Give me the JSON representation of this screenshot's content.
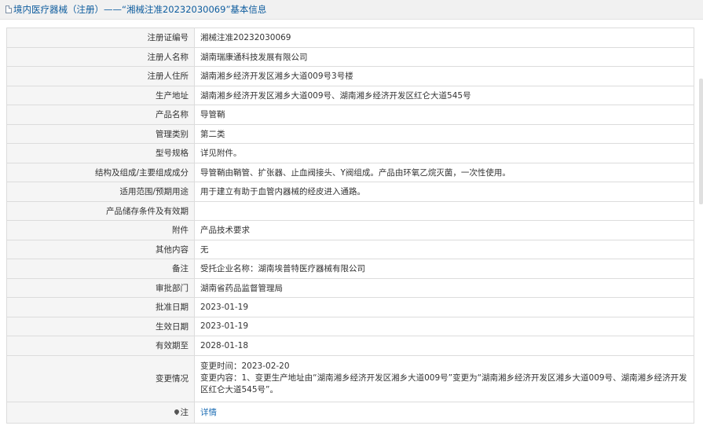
{
  "header": {
    "title": "境内医疗器械（注册）——“湘械注准20232030069”基本信息"
  },
  "rows": [
    {
      "label": "注册证编号",
      "value": "湘械注准20232030069"
    },
    {
      "label": "注册人名称",
      "value": "湖南瑞康通科技发展有限公司"
    },
    {
      "label": "注册人住所",
      "value": "湖南湘乡经济开发区湘乡大道009号3号楼"
    },
    {
      "label": "生产地址",
      "value": "湖南湘乡经济开发区湘乡大道009号、湖南湘乡经济开发区红仑大道545号"
    },
    {
      "label": "产品名称",
      "value": "导管鞘"
    },
    {
      "label": "管理类别",
      "value": "第二类"
    },
    {
      "label": "型号规格",
      "value": "详见附件。"
    },
    {
      "label": "结构及组成/主要组成成分",
      "value": "导管鞘由鞘管、扩张器、止血阀接头、Y阀组成。产品由环氧乙烷灭菌，一次性使用。"
    },
    {
      "label": "适用范围/预期用途",
      "value": "用于建立有助于血管内器械的经皮进入通路。"
    },
    {
      "label": "产品储存条件及有效期",
      "value": ""
    },
    {
      "label": "附件",
      "value": "产品技术要求"
    },
    {
      "label": "其他内容",
      "value": "无"
    },
    {
      "label": "备注",
      "value": "受托企业名称：湖南埃普特医疗器械有限公司"
    },
    {
      "label": "审批部门",
      "value": "湖南省药品监督管理局"
    },
    {
      "label": "批准日期",
      "value": "2023-01-19"
    },
    {
      "label": "生效日期",
      "value": "2023-01-19"
    },
    {
      "label": "有效期至",
      "value": "2028-01-18"
    }
  ],
  "change": {
    "label": "变更情况",
    "line1": "变更时间：2023-02-20",
    "line2": "变更内容：1、变更生产地址由“湖南湘乡经济开发区湘乡大道009号”变更为“湖南湘乡经济开发区湘乡大道009号、湖南湘乡经济开发区红仑大道545号”。"
  },
  "note": {
    "label": "注",
    "link": "详情"
  }
}
